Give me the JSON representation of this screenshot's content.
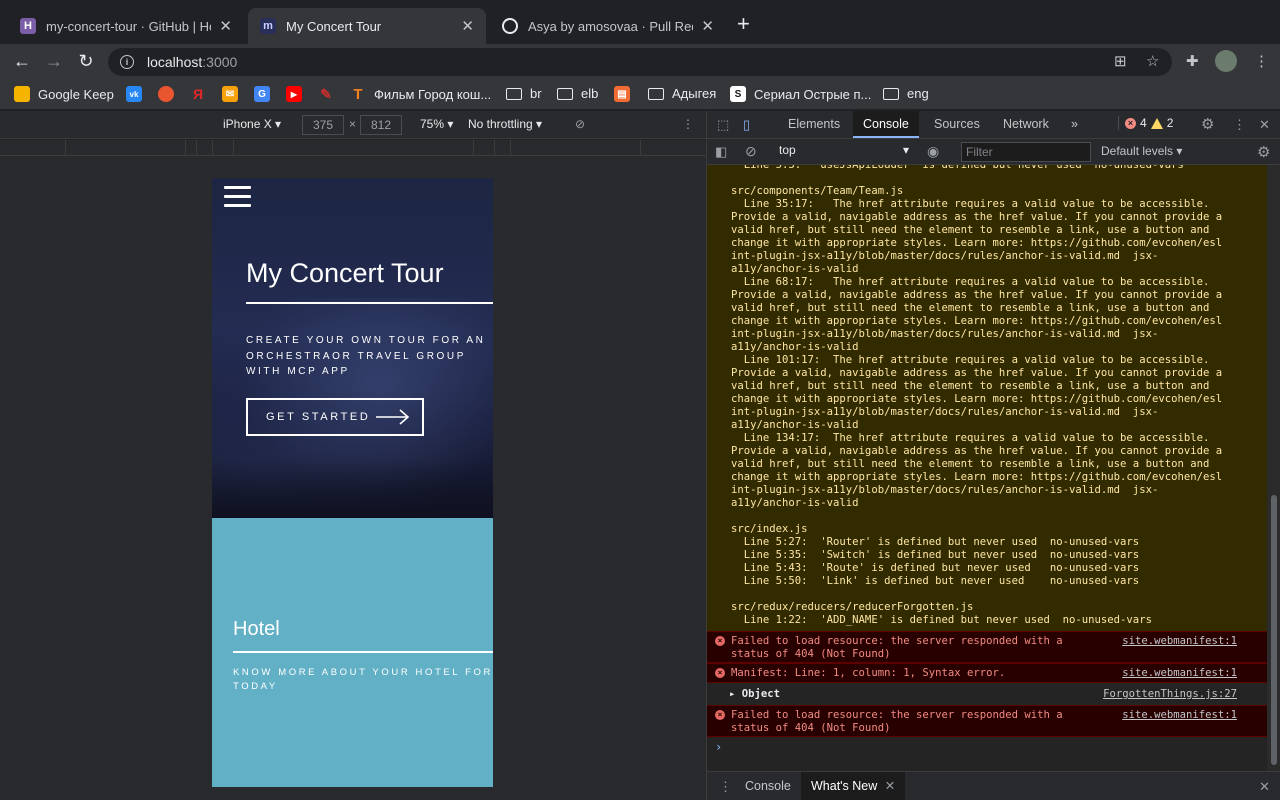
{
  "tabs": [
    {
      "title": "my-concert-tour · GitHub | Her",
      "favicon": "H",
      "favicon_color": "#7b5ea7"
    },
    {
      "title": "My Concert Tour",
      "favicon": "m",
      "favicon_color": "#2a2f5a"
    },
    {
      "title": "Asya by amosovaa · Pull Reque",
      "favicon": "github-icon",
      "favicon_color": "#202124"
    }
  ],
  "address": {
    "host": "localhost",
    "port": ":3000"
  },
  "bookmarks": [
    {
      "label": "Google Keep",
      "color": "#f5b400"
    },
    {
      "label": "",
      "color": "#2787f5",
      "glyph": "vk"
    },
    {
      "label": "",
      "color": "#e8552f",
      "glyph": "●"
    },
    {
      "label": "",
      "color": "#e3262a",
      "glyph": "Я"
    },
    {
      "label": "",
      "color": "#f8a20b",
      "glyph": "✉"
    },
    {
      "label": "",
      "color": "#4285f4",
      "glyph": "G"
    },
    {
      "label": "",
      "color": "#ff0000",
      "glyph": "▶"
    },
    {
      "label": "",
      "color": "#c52f2f",
      "glyph": "✎"
    },
    {
      "label": "Фильм Город кош...",
      "color": "#f5821f",
      "glyph": "T"
    },
    {
      "label": "br",
      "folder": true
    },
    {
      "label": "elb",
      "folder": true
    },
    {
      "label": "",
      "color": "#f06c34",
      "glyph": "▤"
    },
    {
      "label": "Адыгея",
      "folder": true
    },
    {
      "label": "Сериал Острые п...",
      "color": "#111111",
      "glyph": "S"
    },
    {
      "label": "eng",
      "folder": true
    }
  ],
  "device_toolbar": {
    "device": "iPhone X",
    "width": "375",
    "height": "812",
    "times": "×",
    "zoom": "75%",
    "throttle": "No throttling"
  },
  "page": {
    "title": "My Concert Tour",
    "subtitle": "CREATE YOUR OWN TOUR FOR AN ORCHESTRAOR TRAVEL GROUP WITH MCP APP",
    "cta": "GET STARTED",
    "hotel_title": "Hotel",
    "hotel_sub": "KNOW MORE ABOUT YOUR HOTEL FOR TODAY",
    "hero_color": "#1d2543",
    "hotel_color": "#62b0c6"
  },
  "devtools": {
    "tabs": [
      "Elements",
      "Console",
      "Sources",
      "Network"
    ],
    "more": "»",
    "errors": "4",
    "warnings": "2",
    "context": "top",
    "filter_placeholder": "Filter",
    "levels": "Default levels",
    "warning_text": "  Line 5:3:  'useJsApiLoader' is defined but never used  no-unused-vars\n\nsrc/components/Team/Team.js\n  Line 35:17:   The href attribute requires a valid value to be accessible.\nProvide a valid, navigable address as the href value. If you cannot provide a\nvalid href, but still need the element to resemble a link, use a button and\nchange it with appropriate styles. Learn more: https://github.com/evcohen/esl\nint-plugin-jsx-a11y/blob/master/docs/rules/anchor-is-valid.md  jsx-\na11y/anchor-is-valid\n  Line 68:17:   The href attribute requires a valid value to be accessible.\nProvide a valid, navigable address as the href value. If you cannot provide a\nvalid href, but still need the element to resemble a link, use a button and\nchange it with appropriate styles. Learn more: https://github.com/evcohen/esl\nint-plugin-jsx-a11y/blob/master/docs/rules/anchor-is-valid.md  jsx-\na11y/anchor-is-valid\n  Line 101:17:  The href attribute requires a valid value to be accessible.\nProvide a valid, navigable address as the href value. If you cannot provide a\nvalid href, but still need the element to resemble a link, use a button and\nchange it with appropriate styles. Learn more: https://github.com/evcohen/esl\nint-plugin-jsx-a11y/blob/master/docs/rules/anchor-is-valid.md  jsx-\na11y/anchor-is-valid\n  Line 134:17:  The href attribute requires a valid value to be accessible.\nProvide a valid, navigable address as the href value. If you cannot provide a\nvalid href, but still need the element to resemble a link, use a button and\nchange it with appropriate styles. Learn more: https://github.com/evcohen/esl\nint-plugin-jsx-a11y/blob/master/docs/rules/anchor-is-valid.md  jsx-\na11y/anchor-is-valid\n\nsrc/index.js\n  Line 5:27:  'Router' is defined but never used  no-unused-vars\n  Line 5:35:  'Switch' is defined but never used  no-unused-vars\n  Line 5:43:  'Route' is defined but never used   no-unused-vars\n  Line 5:50:  'Link' is defined but never used    no-unused-vars\n\nsrc/redux/reducers/reducerForgotten.js\n  Line 1:22:  'ADD_NAME' is defined but never used  no-unused-vars",
    "messages": [
      {
        "type": "error",
        "text": "Failed to load resource: the server responded with a\nstatus of 404 (Not Found)",
        "source": "site.webmanifest:1"
      },
      {
        "type": "error",
        "text": "Manifest: Line: 1, column: 1, Syntax error.",
        "source": "site.webmanifest:1"
      },
      {
        "type": "object",
        "text": "Object",
        "source": "ForgottenThings.js:27"
      },
      {
        "type": "error",
        "text": "Failed to load resource: the server responded with a\nstatus of 404 (Not Found)",
        "source": "site.webmanifest:1"
      }
    ],
    "prompt": "›",
    "drawer_tabs": [
      "Console",
      "What's New"
    ]
  }
}
